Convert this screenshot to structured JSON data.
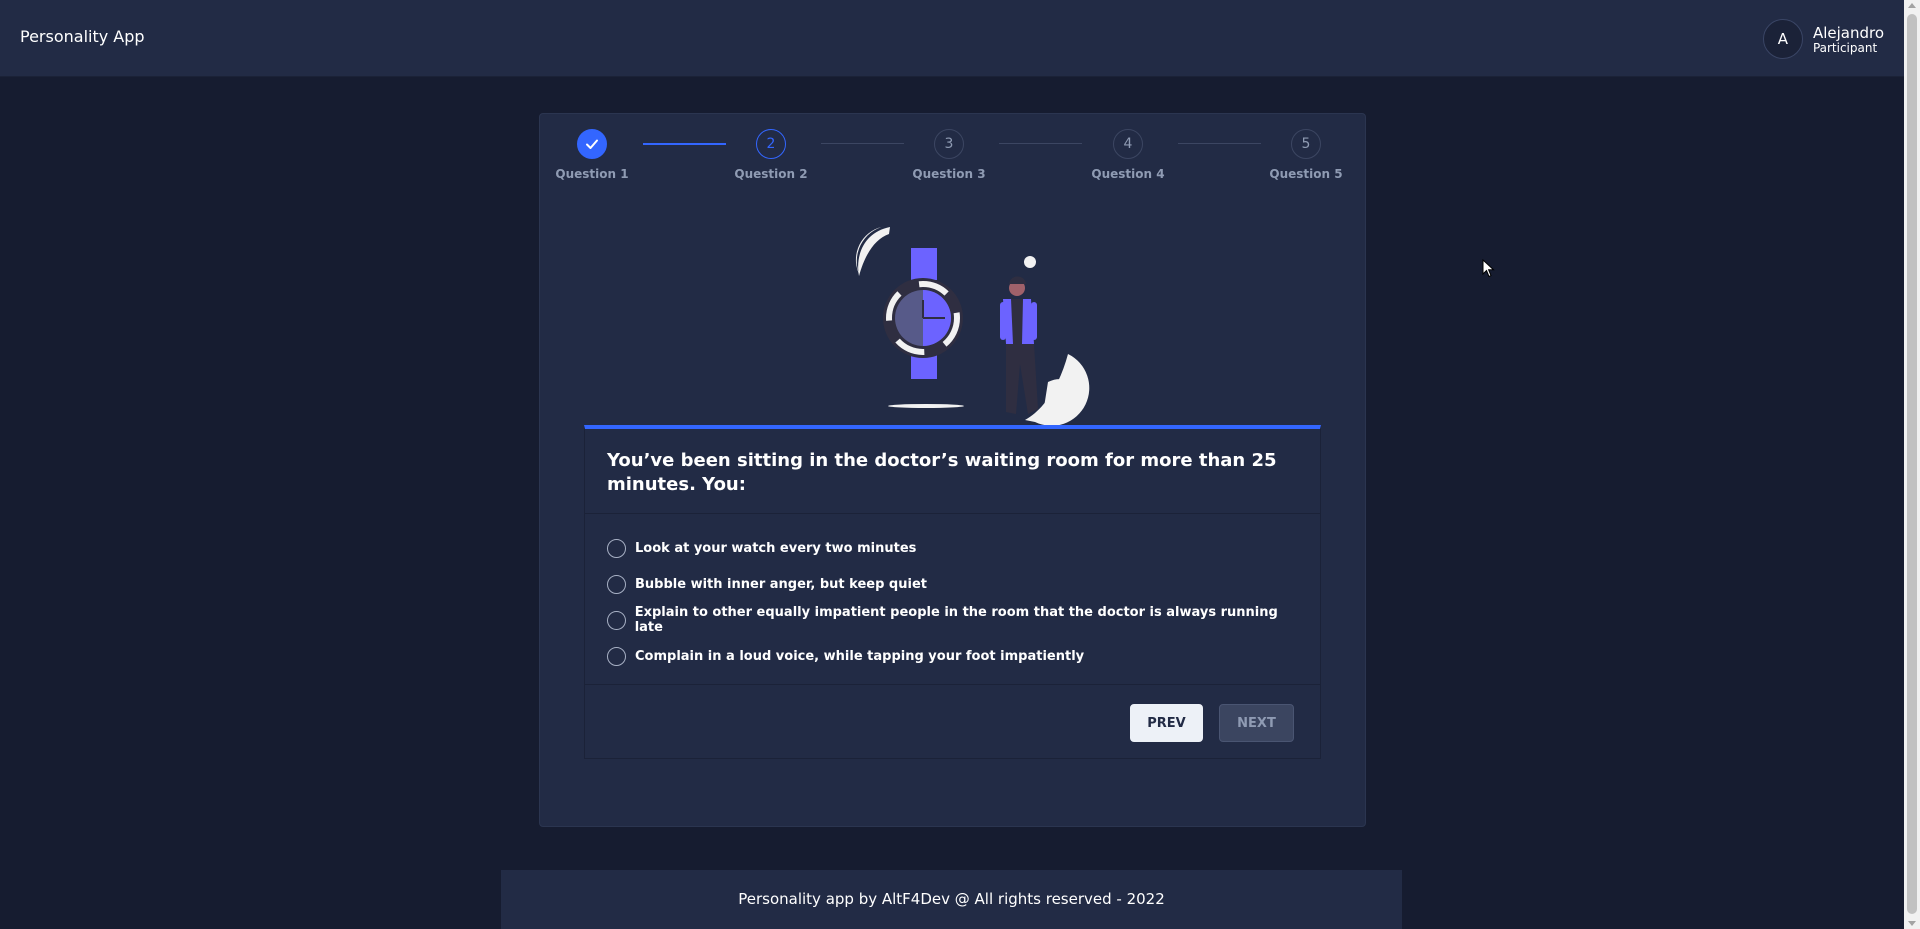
{
  "header": {
    "app_title": "Personality App"
  },
  "user": {
    "avatar_initial": "A",
    "name": "Alejandro",
    "role": "Participant"
  },
  "stepper": {
    "steps": [
      {
        "number": "1",
        "label": "Question 1",
        "state": "done"
      },
      {
        "number": "2",
        "label": "Question 2",
        "state": "active"
      },
      {
        "number": "3",
        "label": "Question 3",
        "state": "pending"
      },
      {
        "number": "4",
        "label": "Question 4",
        "state": "pending"
      },
      {
        "number": "5",
        "label": "Question 5",
        "state": "pending"
      }
    ]
  },
  "question": {
    "text": "You’ve been sitting in the doctor’s waiting room for more than 25 minutes. You:",
    "options": [
      "Look at your watch every two minutes",
      "Bubble with inner anger, but keep quiet",
      "Explain to other equally impatient people in the room that the doctor is always running late",
      "Complain in a loud voice, while tapping your foot impatiently"
    ]
  },
  "buttons": {
    "prev": "PREV",
    "next": "NEXT"
  },
  "footer": {
    "text": "Personality app by AltF4Dev @ All rights reserved - 2022"
  },
  "colors": {
    "accent": "#3366ff",
    "background": "#161c30",
    "surface": "#222b45",
    "illustration_purple": "#6c63ff"
  }
}
